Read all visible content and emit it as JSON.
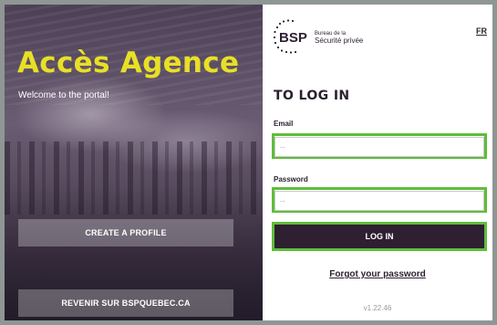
{
  "hero": {
    "title": "Accès Agence",
    "subtitle": "Welcome to the portal!",
    "create_profile_label": "CREATE A PROFILE",
    "return_label": "REVENIR SUR BSPQUEBEC.CA"
  },
  "header": {
    "logo_acronym": "BSP",
    "logo_line1": "Bureau de la",
    "logo_line2": "Sécurité privée",
    "language_link": "FR"
  },
  "login": {
    "title": "TO LOG IN",
    "email_label": "Email",
    "email_placeholder": "...",
    "password_label": "Password",
    "password_placeholder": "...",
    "submit_label": "LOG IN",
    "forgot_label": "Forgot your password",
    "version": "v1.22.46"
  },
  "colors": {
    "accent_yellow": "#e8e025",
    "primary_dark": "#2e1f32",
    "focus_green": "#5fbd3a",
    "page_bg": "#8e9793"
  }
}
